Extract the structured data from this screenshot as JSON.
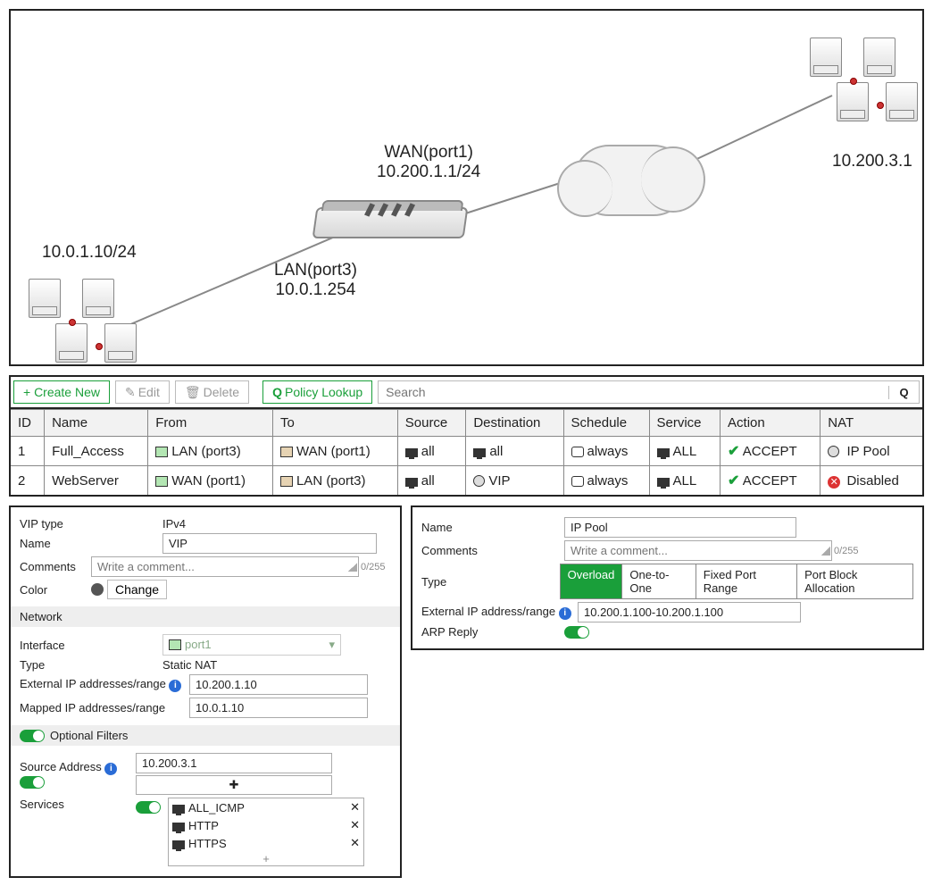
{
  "diagram": {
    "wan_label_line1": "WAN(port1)",
    "wan_label_line2": "10.200.1.1/24",
    "lan_label_line1": "LAN(port3)",
    "lan_label_line2": "10.0.1.254",
    "left_net": "10.0.1.10/24",
    "right_net": "10.200.3.1"
  },
  "toolbar": {
    "create_new": "+ Create New",
    "edit": "Edit",
    "delete": "Delete",
    "policy_lookup": "Policy Lookup",
    "search_placeholder": "Search"
  },
  "policy_table": {
    "headers": [
      "ID",
      "Name",
      "From",
      "To",
      "Source",
      "Destination",
      "Schedule",
      "Service",
      "Action",
      "NAT"
    ],
    "rows": [
      {
        "id": "1",
        "name": "Full_Access",
        "from": "LAN (port3)",
        "to": "WAN (port1)",
        "source": "all",
        "destination": "all",
        "schedule": "always",
        "service": "ALL",
        "action": "ACCEPT",
        "nat": "IP Pool",
        "nat_icon": "pool"
      },
      {
        "id": "2",
        "name": "WebServer",
        "from": "WAN (port1)",
        "to": "LAN (port3)",
        "source": "all",
        "destination": "VIP",
        "schedule": "always",
        "service": "ALL",
        "action": "ACCEPT",
        "nat": "Disabled",
        "nat_icon": "x"
      }
    ]
  },
  "vip_panel": {
    "vip_type_label": "VIP type",
    "vip_type_value": "IPv4",
    "name_label": "Name",
    "name_value": "VIP",
    "comments_label": "Comments",
    "comments_placeholder": "Write a comment...",
    "comments_count": "0/255",
    "color_label": "Color",
    "change_btn": "Change",
    "network_hdr": "Network",
    "interface_label": "Interface",
    "interface_value": "port1",
    "type_label": "Type",
    "type_value": "Static NAT",
    "ext_ip_label": "External IP addresses/range",
    "ext_ip_value": "10.200.1.10",
    "map_ip_label": "Mapped IP addresses/range",
    "map_ip_value": "10.0.1.10",
    "opt_filters_hdr": "Optional Filters",
    "src_addr_label": "Source Address",
    "src_addr_value": "10.200.3.1",
    "services_label": "Services",
    "services": [
      "ALL_ICMP",
      "HTTP",
      "HTTPS"
    ]
  },
  "pool_panel": {
    "name_label": "Name",
    "name_value": "IP Pool",
    "comments_label": "Comments",
    "comments_placeholder": "Write a comment...",
    "comments_count": "0/255",
    "type_label": "Type",
    "type_options": [
      "Overload",
      "One-to-One",
      "Fixed Port Range",
      "Port Block Allocation"
    ],
    "type_selected": "Overload",
    "ext_range_label": "External IP address/range",
    "ext_range_value": "10.200.1.100-10.200.1.100",
    "arp_label": "ARP Reply"
  }
}
